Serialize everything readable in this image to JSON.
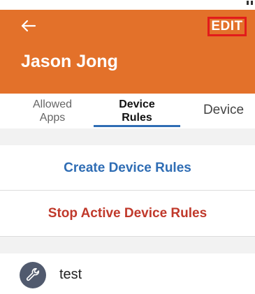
{
  "header": {
    "back_icon": "arrow-left-icon",
    "edit_label": "EDIT",
    "title": "Jason Jong",
    "color": "#e3712a"
  },
  "tabs": [
    {
      "label_line1": "Allowed",
      "label_line2": "Apps"
    },
    {
      "label_line1": "Device",
      "label_line2": "Rules",
      "active": true
    },
    {
      "label": "Device"
    }
  ],
  "actions": {
    "create_label": "Create Device Rules",
    "stop_label": "Stop Active Device Rules",
    "create_color": "#2f6db4",
    "stop_color": "#c0392b"
  },
  "rules": [
    {
      "icon": "wrench-icon",
      "name": "test"
    }
  ]
}
